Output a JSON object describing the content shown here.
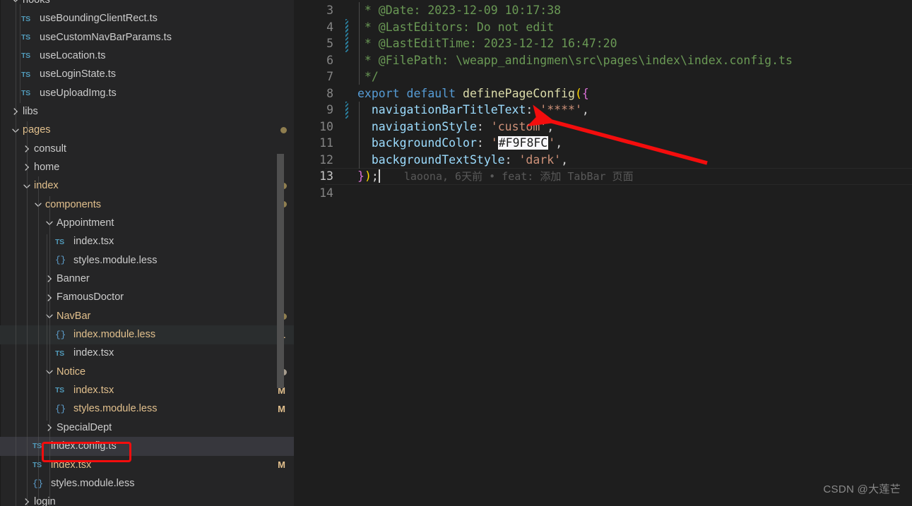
{
  "app": {
    "theme_bg": "#1e1e1e",
    "sidebar_bg": "#252526",
    "accent_red": "#f40d0d"
  },
  "sidebar": {
    "items": [
      {
        "label": "hooks",
        "kind": "folder",
        "state": "expanded",
        "indent": 1,
        "icon": "chevron-down-icon",
        "color": "plain",
        "badge": "",
        "dot": ""
      },
      {
        "label": "useBoundingClientRect.ts",
        "kind": "file",
        "state": "",
        "indent": 2,
        "icon": "ts-file-icon",
        "color": "plain",
        "badge": "",
        "dot": ""
      },
      {
        "label": "useCustomNavBarParams.ts",
        "kind": "file",
        "state": "",
        "indent": 2,
        "icon": "ts-file-icon",
        "color": "plain",
        "badge": "",
        "dot": ""
      },
      {
        "label": "useLocation.ts",
        "kind": "file",
        "state": "",
        "indent": 2,
        "icon": "ts-file-icon",
        "color": "plain",
        "badge": "",
        "dot": ""
      },
      {
        "label": "useLoginState.ts",
        "kind": "file",
        "state": "",
        "indent": 2,
        "icon": "ts-file-icon",
        "color": "plain",
        "badge": "",
        "dot": ""
      },
      {
        "label": "useUploadImg.ts",
        "kind": "file",
        "state": "",
        "indent": 2,
        "icon": "ts-file-icon",
        "color": "plain",
        "badge": "",
        "dot": ""
      },
      {
        "label": "libs",
        "kind": "folder",
        "state": "collapsed",
        "indent": 1,
        "icon": "chevron-right-icon",
        "color": "plain",
        "badge": "",
        "dot": ""
      },
      {
        "label": "pages",
        "kind": "folder",
        "state": "expanded",
        "indent": 1,
        "icon": "chevron-down-icon",
        "color": "mod",
        "badge": "",
        "dot": "mod"
      },
      {
        "label": "consult",
        "kind": "folder",
        "state": "collapsed",
        "indent": 2,
        "icon": "chevron-right-icon",
        "color": "plain",
        "badge": "",
        "dot": ""
      },
      {
        "label": "home",
        "kind": "folder",
        "state": "collapsed",
        "indent": 2,
        "icon": "chevron-right-icon",
        "color": "plain",
        "badge": "",
        "dot": ""
      },
      {
        "label": "index",
        "kind": "folder",
        "state": "expanded",
        "indent": 2,
        "icon": "chevron-down-icon",
        "color": "mod",
        "badge": "",
        "dot": "mod"
      },
      {
        "label": "components",
        "kind": "folder",
        "state": "expanded",
        "indent": 3,
        "icon": "chevron-down-icon",
        "color": "mod",
        "badge": "",
        "dot": "mod"
      },
      {
        "label": "Appointment",
        "kind": "folder",
        "state": "expanded",
        "indent": 4,
        "icon": "chevron-down-icon",
        "color": "plain",
        "badge": "",
        "dot": ""
      },
      {
        "label": "index.tsx",
        "kind": "file",
        "state": "",
        "indent": 5,
        "icon": "ts-file-icon",
        "color": "plain",
        "badge": "",
        "dot": ""
      },
      {
        "label": "styles.module.less",
        "kind": "file",
        "state": "",
        "indent": 5,
        "icon": "less-file-icon",
        "color": "plain",
        "badge": "",
        "dot": ""
      },
      {
        "label": "Banner",
        "kind": "folder",
        "state": "collapsed",
        "indent": 4,
        "icon": "chevron-right-icon",
        "color": "plain",
        "badge": "",
        "dot": ""
      },
      {
        "label": "FamousDoctor",
        "kind": "folder",
        "state": "collapsed",
        "indent": 4,
        "icon": "chevron-right-icon",
        "color": "plain",
        "badge": "",
        "dot": ""
      },
      {
        "label": "NavBar",
        "kind": "folder",
        "state": "expanded",
        "indent": 4,
        "icon": "chevron-down-icon",
        "color": "mod",
        "badge": "",
        "dot": "mod"
      },
      {
        "label": "index.module.less",
        "kind": "file",
        "state": "",
        "indent": 5,
        "icon": "less-file-icon",
        "color": "mod",
        "badge": "1",
        "dot": "",
        "row": "highlighted"
      },
      {
        "label": "index.tsx",
        "kind": "file",
        "state": "",
        "indent": 5,
        "icon": "ts-file-icon",
        "color": "plain",
        "badge": "",
        "dot": ""
      },
      {
        "label": "Notice",
        "kind": "folder",
        "state": "expanded",
        "indent": 4,
        "icon": "chevron-down-icon",
        "color": "mod",
        "badge": "",
        "dot": "modlight"
      },
      {
        "label": "index.tsx",
        "kind": "file",
        "state": "",
        "indent": 5,
        "icon": "ts-file-icon",
        "color": "mod",
        "badge": "M",
        "dot": ""
      },
      {
        "label": "styles.module.less",
        "kind": "file",
        "state": "",
        "indent": 5,
        "icon": "less-file-icon",
        "color": "mod",
        "badge": "M",
        "dot": ""
      },
      {
        "label": "SpecialDept",
        "kind": "folder",
        "state": "collapsed",
        "indent": 4,
        "icon": "chevron-right-icon",
        "color": "plain",
        "badge": "",
        "dot": ""
      },
      {
        "label": "index.config.ts",
        "kind": "file",
        "state": "",
        "indent": 3,
        "icon": "ts-file-icon",
        "color": "plain",
        "badge": "",
        "dot": "",
        "row": "selected"
      },
      {
        "label": "index.tsx",
        "kind": "file",
        "state": "",
        "indent": 3,
        "icon": "ts-file-icon",
        "color": "mod",
        "badge": "M",
        "dot": ""
      },
      {
        "label": "styles.module.less",
        "kind": "file",
        "state": "",
        "indent": 3,
        "icon": "less-file-icon",
        "color": "plain",
        "badge": "",
        "dot": ""
      },
      {
        "label": "login",
        "kind": "folder",
        "state": "collapsed",
        "indent": 2,
        "icon": "chevron-right-icon",
        "color": "plain",
        "badge": "",
        "dot": ""
      }
    ]
  },
  "editor": {
    "lines": [
      {
        "num": "3",
        "changed": false,
        "active": false,
        "tokens": [
          {
            "t": " * @Date: 2023-12-09 10:17:38",
            "c": "tok-com"
          }
        ]
      },
      {
        "num": "4",
        "changed": true,
        "active": false,
        "tokens": [
          {
            "t": " * @LastEditors: Do not edit",
            "c": "tok-com"
          }
        ]
      },
      {
        "num": "5",
        "changed": true,
        "active": false,
        "tokens": [
          {
            "t": " * @LastEditTime: 2023-12-12 16:47:20",
            "c": "tok-com"
          }
        ]
      },
      {
        "num": "6",
        "changed": false,
        "active": false,
        "tokens": [
          {
            "t": " * @FilePath: \\weapp_andingmen\\src\\pages\\index\\index.config.ts",
            "c": "tok-com"
          }
        ]
      },
      {
        "num": "7",
        "changed": false,
        "active": false,
        "tokens": [
          {
            "t": " */",
            "c": "tok-com"
          }
        ]
      },
      {
        "num": "8",
        "changed": false,
        "active": false,
        "tokens": [
          {
            "t": "export",
            "c": "tok-kw"
          },
          {
            "t": " ",
            "c": "tok-plain"
          },
          {
            "t": "default",
            "c": "tok-kw"
          },
          {
            "t": " ",
            "c": "tok-plain"
          },
          {
            "t": "definePageConfig",
            "c": "tok-fn"
          },
          {
            "t": "(",
            "c": "tok-p1"
          },
          {
            "t": "{",
            "c": "tok-p2"
          }
        ]
      },
      {
        "num": "9",
        "changed": true,
        "active": false,
        "tokens": [
          {
            "t": "  ",
            "c": "tok-plain"
          },
          {
            "t": "navigationBarTitleText",
            "c": "tok-prop"
          },
          {
            "t": ":",
            "c": "tok-plain"
          },
          {
            "t": " ",
            "c": "tok-plain"
          },
          {
            "t": "'****'",
            "c": "tok-str"
          },
          {
            "t": ",",
            "c": "tok-plain"
          }
        ]
      },
      {
        "num": "10",
        "changed": false,
        "active": false,
        "tokens": [
          {
            "t": "  ",
            "c": "tok-plain"
          },
          {
            "t": "navigationStyle",
            "c": "tok-prop"
          },
          {
            "t": ":",
            "c": "tok-plain"
          },
          {
            "t": " ",
            "c": "tok-plain"
          },
          {
            "t": "'custom'",
            "c": "tok-str"
          },
          {
            "t": ",",
            "c": "tok-plain"
          }
        ]
      },
      {
        "num": "11",
        "changed": false,
        "active": false,
        "tokens": [
          {
            "t": "  ",
            "c": "tok-plain"
          },
          {
            "t": "backgroundColor",
            "c": "tok-prop"
          },
          {
            "t": ":",
            "c": "tok-plain"
          },
          {
            "t": " ",
            "c": "tok-plain"
          },
          {
            "t": "'",
            "c": "tok-str"
          },
          {
            "t": "#F9F8FC",
            "c": "colorbox"
          },
          {
            "t": "'",
            "c": "tok-str"
          },
          {
            "t": ",",
            "c": "tok-plain"
          }
        ]
      },
      {
        "num": "12",
        "changed": false,
        "active": false,
        "tokens": [
          {
            "t": "  ",
            "c": "tok-plain"
          },
          {
            "t": "backgroundTextStyle",
            "c": "tok-prop"
          },
          {
            "t": ":",
            "c": "tok-plain"
          },
          {
            "t": " ",
            "c": "tok-plain"
          },
          {
            "t": "'dark'",
            "c": "tok-str"
          },
          {
            "t": ",",
            "c": "tok-plain"
          }
        ]
      },
      {
        "num": "13",
        "changed": false,
        "active": true,
        "tokens": [
          {
            "t": "}",
            "c": "tok-p2"
          },
          {
            "t": ")",
            "c": "tok-p1"
          },
          {
            "t": ";",
            "c": "tok-plain"
          }
        ],
        "blame": "laoona, 6天前 • feat: 添加 TabBar 页面"
      },
      {
        "num": "14",
        "changed": false,
        "active": false,
        "tokens": []
      }
    ]
  },
  "annotations": {
    "arrow_color": "#f40d0d",
    "file_highlight_box": "index.config.ts",
    "arrow_points_at": "navigationStyle: 'custom',"
  },
  "watermark": {
    "text": "CSDN @大莲芒"
  }
}
